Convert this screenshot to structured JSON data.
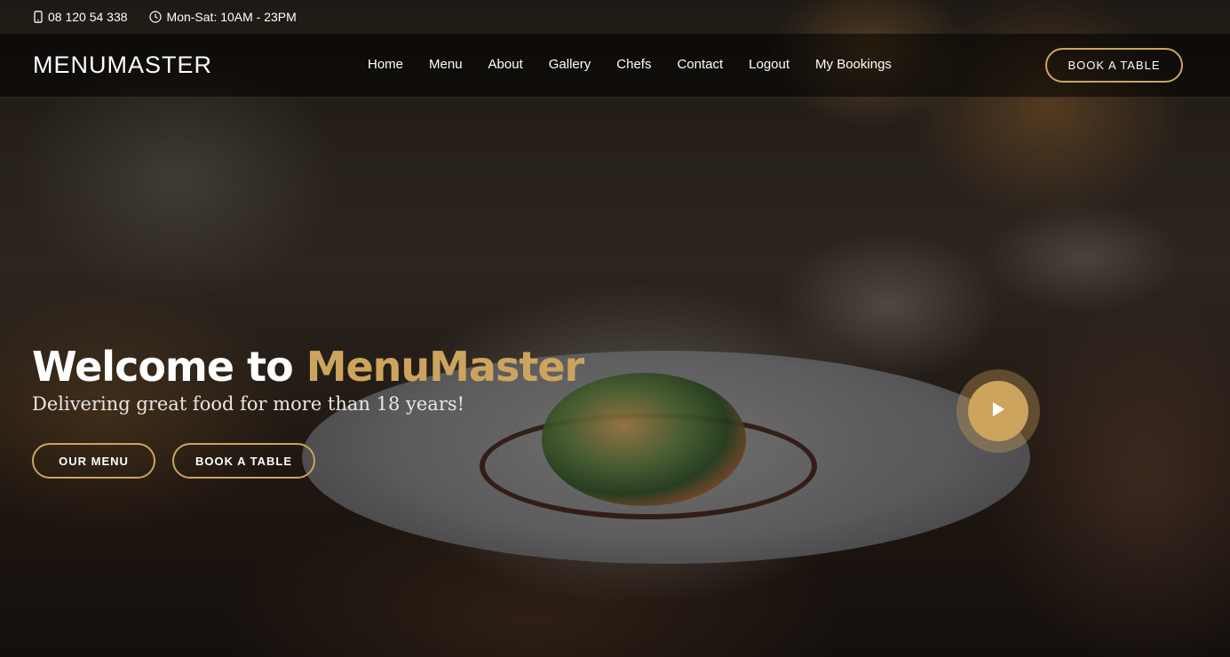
{
  "topbar": {
    "phone": "08 120 54 338",
    "hours": "Mon-Sat: 10AM - 23PM",
    "phone_icon": "phone-icon",
    "clock_icon": "clock-icon"
  },
  "header": {
    "logo": "MENUMASTER",
    "nav": [
      "Home",
      "Menu",
      "About",
      "Gallery",
      "Chefs",
      "Contact",
      "Logout",
      "My Bookings"
    ],
    "book_label": "BOOK A TABLE"
  },
  "hero": {
    "title_prefix": "Welcome to ",
    "title_accent": "MenuMaster",
    "subtitle": "Delivering great food for more than 18 years!",
    "btn_menu": "OUR MENU",
    "btn_book": "BOOK A TABLE",
    "play_icon": "play-icon"
  },
  "colors": {
    "accent": "#cda45e",
    "text": "#ffffff"
  }
}
